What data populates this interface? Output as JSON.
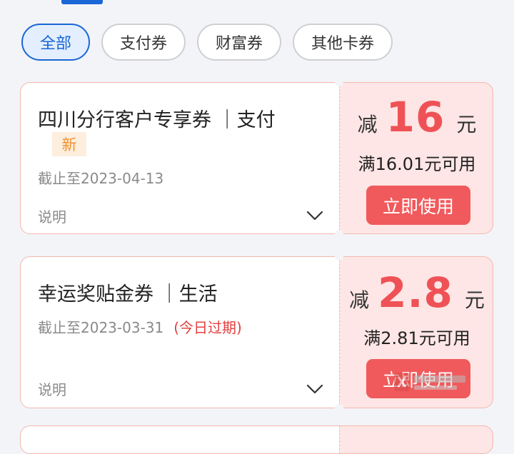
{
  "filters": [
    "全部",
    "支付券",
    "财富券",
    "其他卡券"
  ],
  "coupons": [
    {
      "title": "四川分行客户专享券 ｜支付",
      "badge": "新",
      "deadline": "截止至2023-04-13",
      "expiry_note": "",
      "desc_label": "说明",
      "amount_prefix": "减",
      "amount": "16",
      "amount_unit": "元",
      "condition": "满16.01元可用",
      "button": "立即使用"
    },
    {
      "title": "幸运奖贴金券 ｜生活",
      "deadline": "截止至2023-03-31",
      "expiry_note": "(今日过期)",
      "desc_label": "说明",
      "amount_prefix": "减",
      "amount": "2.8",
      "amount_unit": "元",
      "condition": "满2.81元可用",
      "button": "立即使用"
    }
  ],
  "colors": {
    "accent": "#1a66d6",
    "coupon_red": "#ef5256",
    "coupon_bg": "#fde6e5",
    "badge_orange": "#f0902f"
  },
  "icons": [
    "chevron-down-icon",
    "watermark-logo"
  ]
}
